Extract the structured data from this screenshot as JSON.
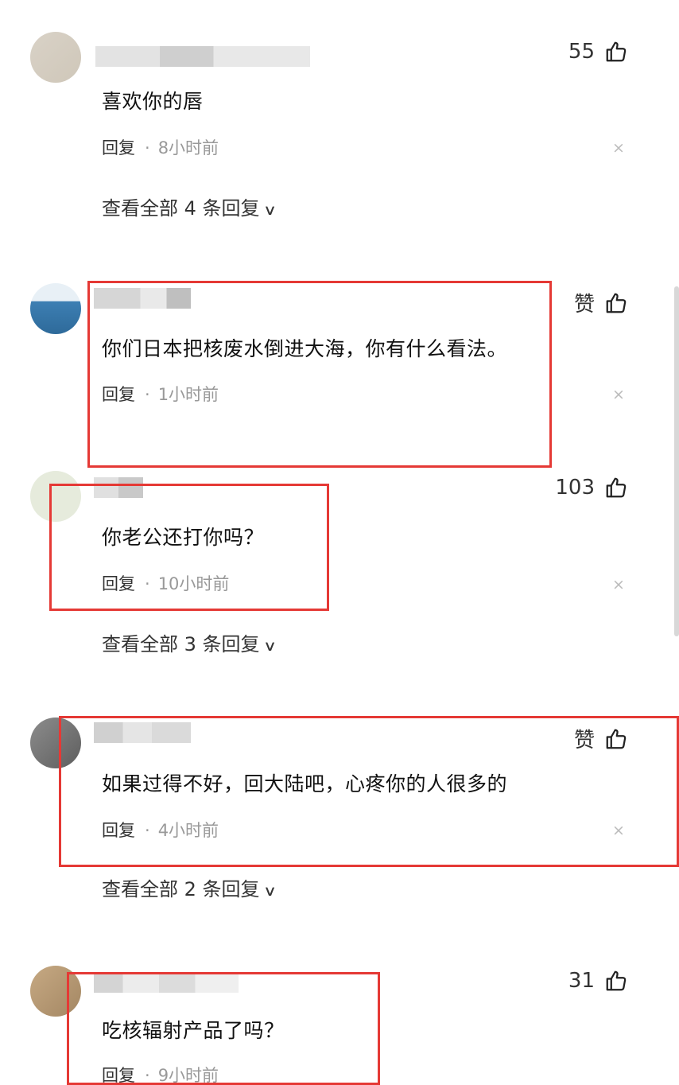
{
  "reply_label": "回复",
  "dot": "·",
  "close_glyph": "×",
  "comments": [
    {
      "likes": "55",
      "text": "喜欢你的唇",
      "time": "8小时前",
      "view_more": "查看全部 4 条回复"
    },
    {
      "likes": "赞",
      "text": "你们日本把核废水倒进大海，你有什么看法。",
      "time": "1小时前"
    },
    {
      "likes": "103",
      "text": "你老公还打你吗？",
      "time": "10小时前",
      "view_more": "查看全部 3 条回复"
    },
    {
      "likes": "赞",
      "text": "如果过得不好，回大陆吧，心疼你的人很多的",
      "time": "4小时前",
      "view_more": "查看全部 2 条回复"
    },
    {
      "likes": "31",
      "text": "吃核辐射产品了吗？",
      "time": "9小时前"
    }
  ],
  "colors": {
    "highlight_box": "#e53935",
    "meta_gray": "#999999"
  }
}
